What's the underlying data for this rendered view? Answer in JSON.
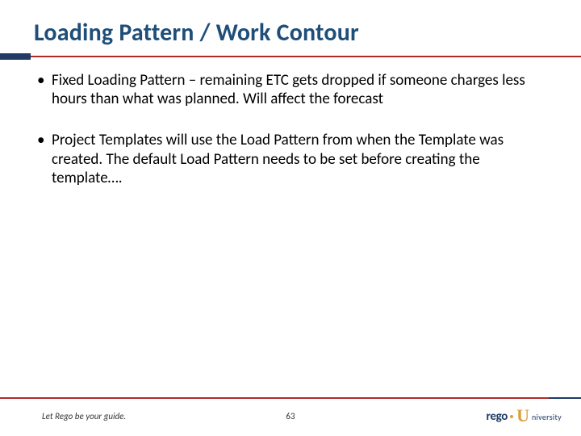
{
  "title": "Loading Pattern / Work Contour",
  "bullets": [
    "Fixed Loading Pattern – remaining ETC gets dropped if someone charges less hours than what was planned.  Will affect the forecast",
    "Project Templates will use the Load Pattern from when the Template was created.  The default Load Pattern needs to be set before creating the template…."
  ],
  "footer": {
    "tagline": "Let Rego be your guide.",
    "page_number": "63",
    "logo_rego": "rego",
    "logo_u": "U",
    "logo_niversity": "niversity"
  },
  "colors": {
    "title": "#1f4e79",
    "rule_navy": "#1f3b66",
    "rule_red": "#b02a2a",
    "logo_gold": "#d9a13b"
  }
}
